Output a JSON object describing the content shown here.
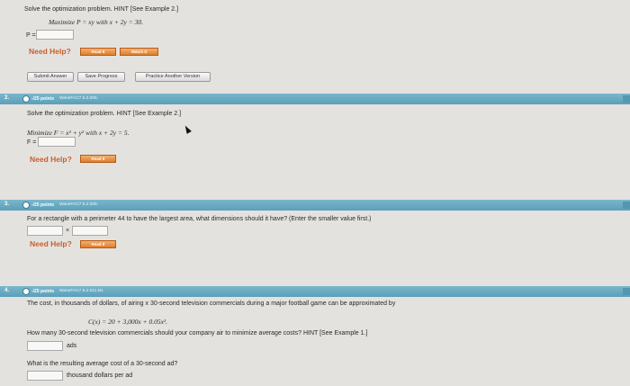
{
  "q1": {
    "instruction": "Solve the optimization problem. HINT [See Example 2.]",
    "maximize": "Maximize P = xy with x + 2y = 30.",
    "p_label": "P =",
    "need_help": "Need Help?",
    "read_it": "Read It",
    "watch_it": "Watch It",
    "actions": {
      "submit": "Submit Answer",
      "save": "Save Progress",
      "practice": "Practice Another Version"
    }
  },
  "q2": {
    "number": "2.",
    "points": "-/25 points",
    "source": "WaneFAC7 5.2.005.",
    "instruction": "Solve the optimization problem. HINT [See Example 2.]",
    "minimize": "Minimize F = x² + y² with x + 2y = 5.",
    "f_label": "F =",
    "need_help": "Need Help?",
    "read_it": "Read It"
  },
  "q3": {
    "number": "3.",
    "points": "-/25 points",
    "source": "WaneFAC7 5.2.009.",
    "question": "For a rectangle with a perimeter 44 to have the largest area, what dimensions should it have? (Enter the smaller value first.)",
    "times": "×",
    "need_help": "Need Help?",
    "read_it": "Read It"
  },
  "q4": {
    "number": "4.",
    "points": "-/25 points",
    "source": "WaneFAC7 5.2.011.MI.",
    "question": "The cost, in thousands of dollars, of airing x 30-second television commercials during a major football game can be approximated by",
    "formula": "C(x) = 20 + 3,000x + 0.05x².",
    "question2": "How many 30-second television commercials should your company air to minimize average costs? HINT [See Example 1.]",
    "ads_unit": "ads",
    "question3": "What is the resulting average cost of a 30-second ad?",
    "cost_unit": "thousand dollars per ad"
  }
}
